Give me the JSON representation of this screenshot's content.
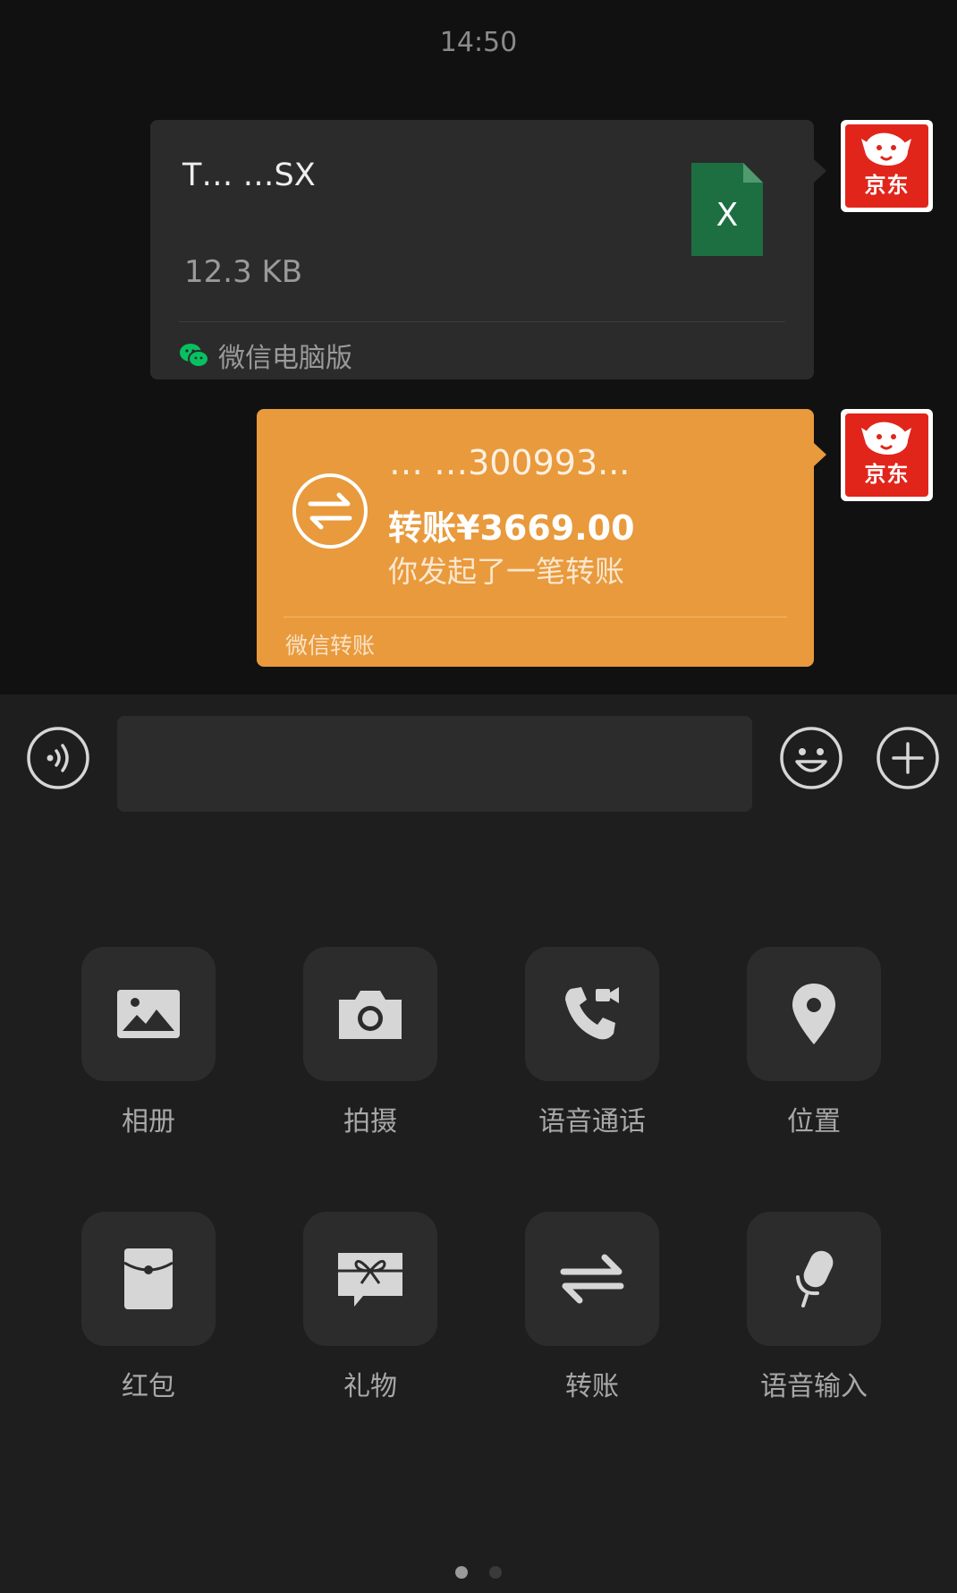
{
  "status": {
    "time": "14:50"
  },
  "messages": {
    "file": {
      "name": "T… …SX",
      "size": "12.3 KB",
      "source": "微信电脑版",
      "icon": "excel-file-icon",
      "icon_letter": "X"
    },
    "transfer": {
      "payee": "… …300993...",
      "amount": "转账¥3669.00",
      "note": "你发起了一笔转账",
      "footer": "微信转账",
      "icon": "transfer-arrows-icon"
    },
    "sender_avatar": {
      "brand": "京东",
      "icon": "jd-dog-logo"
    }
  },
  "input_bar": {
    "placeholder": "",
    "voice_icon": "voice-icon",
    "emoji_icon": "emoji-icon",
    "plus_icon": "plus-icon"
  },
  "actions": [
    {
      "label": "相册",
      "icon": "album-icon"
    },
    {
      "label": "拍摄",
      "icon": "camera-icon"
    },
    {
      "label": "语音通话",
      "icon": "voice-call-icon"
    },
    {
      "label": "位置",
      "icon": "location-icon"
    },
    {
      "label": "红包",
      "icon": "red-packet-icon"
    },
    {
      "label": "礼物",
      "icon": "gift-icon"
    },
    {
      "label": "转账",
      "icon": "transfer-icon"
    },
    {
      "label": "语音输入",
      "icon": "voice-input-icon"
    }
  ],
  "pager": {
    "pages": 2,
    "current": 1
  },
  "colors": {
    "background": "#111111",
    "panel": "#1e1e1e",
    "bubble": "#2b2b2b",
    "transfer": "#e89a3c",
    "excel": "#1d6f42",
    "jd_red": "#e1251b",
    "wechat_green": "#07c160"
  }
}
